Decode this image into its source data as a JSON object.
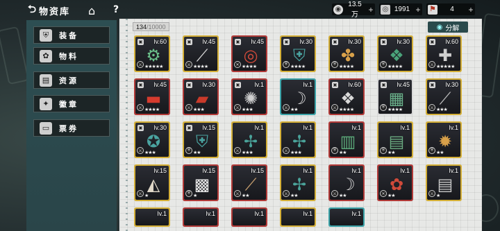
{
  "header": {
    "title": "物资库",
    "back_glyph": "⮌",
    "home_glyph": "⌂",
    "help_glyph": "?"
  },
  "resources": [
    {
      "icon": "coin-icon",
      "glyph": "◉",
      "value": "13.5万"
    },
    {
      "icon": "gem-icon",
      "glyph": "◎",
      "value": "1991"
    },
    {
      "icon": "ticket-icon",
      "glyph": "⚑",
      "value": "4"
    }
  ],
  "resources_plus": "+",
  "tabs": [
    {
      "label": "装备",
      "icon": "shield-icon",
      "glyph": "⛨",
      "active": true
    },
    {
      "label": "物料",
      "icon": "material-icon",
      "glyph": "✿",
      "active": false
    },
    {
      "label": "资源",
      "icon": "book-icon",
      "glyph": "▤",
      "active": false
    },
    {
      "label": "徽章",
      "icon": "badge-icon",
      "glyph": "✦",
      "active": false
    },
    {
      "label": "票券",
      "icon": "ticket-icon",
      "glyph": "▭",
      "active": false
    }
  ],
  "capacity": {
    "current": "134",
    "max": "/10000"
  },
  "decompose_label": "分解",
  "colors": {
    "gold_rarity": "#d4af37",
    "red_rarity": "#b23a38",
    "teal_rarity": "#3ba3a8",
    "panel": "#2d4e52",
    "accent_red": "#c0392b"
  },
  "items": [
    {
      "rarity": "gold",
      "level": "lv.60",
      "locked": true,
      "stars": "★★★★★",
      "art": "cannon",
      "slot": "⚔"
    },
    {
      "rarity": "gold",
      "level": "lv.45",
      "locked": true,
      "stars": "★★★★",
      "art": "spear",
      "slot": "⚔"
    },
    {
      "rarity": "red",
      "level": "lv.45",
      "locked": true,
      "stars": "★★★★",
      "art": "drum",
      "slot": "✕"
    },
    {
      "rarity": "gold",
      "level": "lv.30",
      "locked": true,
      "stars": "★★★★",
      "art": "shield",
      "slot": "⛨"
    },
    {
      "rarity": "gold",
      "level": "lv.30",
      "locked": true,
      "stars": "★★★★",
      "art": "bird",
      "slot": "⛨"
    },
    {
      "rarity": "gold",
      "level": "lv.30",
      "locked": true,
      "stars": "★★★★",
      "art": "shield2",
      "slot": "⛨"
    },
    {
      "rarity": "gold",
      "level": "lv.60",
      "locked": true,
      "stars": "★★★★★",
      "art": "mace",
      "slot": "⚔"
    },
    {
      "rarity": "red",
      "level": "lv.45",
      "locked": true,
      "stars": "★★★★",
      "art": "firecracker",
      "slot": "⚔"
    },
    {
      "rarity": "red",
      "level": "lv.30",
      "locked": true,
      "stars": "★★★",
      "art": "firecracker2",
      "slot": "⚔"
    },
    {
      "rarity": "red",
      "level": "lv.1",
      "locked": true,
      "stars": "★★★",
      "art": "gun",
      "slot": "⚔"
    },
    {
      "rarity": "teal",
      "level": "lv.1",
      "locked": false,
      "stars": "★★",
      "art": "bow",
      "slot": "⚔"
    },
    {
      "rarity": "red",
      "level": "lv.60",
      "locked": true,
      "stars": "★★★★",
      "art": "lantern",
      "slot": "⚔"
    },
    {
      "rarity": "grey",
      "level": "lv.45",
      "locked": true,
      "stars": "★★★★",
      "art": "crate",
      "slot": "⛨"
    },
    {
      "rarity": "gold",
      "level": "lv.30",
      "locked": true,
      "stars": "★★★",
      "art": "staff",
      "slot": "⚔"
    },
    {
      "rarity": "gold",
      "level": "lv.30",
      "locked": true,
      "stars": "★★★",
      "art": "axe",
      "slot": "⚔"
    },
    {
      "rarity": "gold",
      "level": "lv.15",
      "locked": true,
      "stars": "★★",
      "art": "shield3",
      "slot": "⛨"
    },
    {
      "rarity": "gold",
      "level": "lv.1",
      "locked": false,
      "stars": "★★★",
      "art": "dragonfly",
      "slot": "⚔"
    },
    {
      "rarity": "gold",
      "level": "lv.1",
      "locked": false,
      "stars": "★★★",
      "art": "dragonfly2",
      "slot": "⚔"
    },
    {
      "rarity": "red",
      "level": "lv.1",
      "locked": false,
      "stars": "★★",
      "art": "box",
      "slot": "⛨"
    },
    {
      "rarity": "gold",
      "level": "lv.1",
      "locked": false,
      "stars": "★★",
      "art": "scroll",
      "slot": "⛨"
    },
    {
      "rarity": "gold",
      "level": "lv.1",
      "locked": false,
      "stars": "★★",
      "art": "helm",
      "slot": "⛨"
    },
    {
      "rarity": "gold",
      "level": "lv.15",
      "locked": false,
      "stars": "★",
      "art": "fan",
      "slot": "⚔"
    },
    {
      "rarity": "red",
      "level": "lv.15",
      "locked": false,
      "stars": "★",
      "art": "checker",
      "slot": "⛨"
    },
    {
      "rarity": "red",
      "level": "lv.15",
      "locked": false,
      "stars": "★★",
      "art": "flute",
      "slot": "⚔"
    },
    {
      "rarity": "gold",
      "level": "lv.1",
      "locked": false,
      "stars": "★★",
      "art": "dragonfly3",
      "slot": "⚔"
    },
    {
      "rarity": "red",
      "level": "lv.1",
      "locked": false,
      "stars": "★★",
      "art": "crossbow",
      "slot": "⚔"
    },
    {
      "rarity": "red",
      "level": "lv.1",
      "locked": false,
      "stars": "★★",
      "art": "mask",
      "slot": "✕"
    },
    {
      "rarity": "gold",
      "level": "lv.1",
      "locked": false,
      "stars": "★",
      "art": "gatling",
      "slot": "⚔"
    },
    {
      "rarity": "gold",
      "level": "lv.1",
      "locked": false,
      "stars": "",
      "art": "",
      "slot": ""
    },
    {
      "rarity": "red",
      "level": "lv.1",
      "locked": false,
      "stars": "",
      "art": "",
      "slot": ""
    },
    {
      "rarity": "red",
      "level": "lv.1",
      "locked": false,
      "stars": "",
      "art": "",
      "slot": ""
    },
    {
      "rarity": "gold",
      "level": "lv.1",
      "locked": false,
      "stars": "",
      "art": "",
      "slot": ""
    },
    {
      "rarity": "teal",
      "level": "lv.1",
      "locked": false,
      "stars": "",
      "art": "",
      "slot": ""
    }
  ]
}
